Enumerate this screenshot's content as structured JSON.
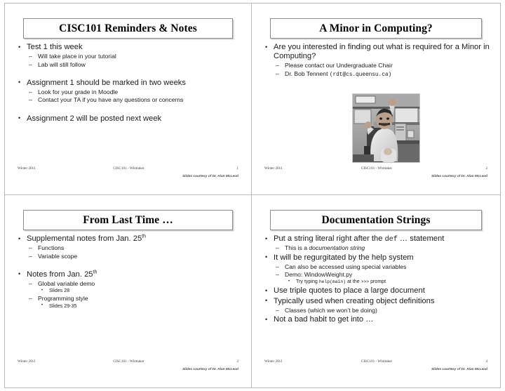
{
  "document": {
    "kind": "lecture-slide-handout",
    "course": "CISC101",
    "grid": "2x2"
  },
  "footer_common": {
    "term": "Winter 2011",
    "course": "CISC101 - Whittaker",
    "credit": "Slides courtesy of Dr. Alan McLeod"
  },
  "slides": [
    {
      "number": "1",
      "title": "CISC101 Reminders & Notes",
      "bullets": [
        {
          "text": "Test 1 this week",
          "sub": [
            {
              "text": "Will take place in your tutorial"
            },
            {
              "text": "Lab will still follow"
            }
          ]
        },
        {
          "text": "Assignment 1 should be marked in two weeks",
          "sub": [
            {
              "text": "Look for your grade in Moodle"
            },
            {
              "text": "Contact your TA if you have any questions or concerns"
            }
          ]
        },
        {
          "text": "Assignment 2 will be posted next week",
          "sub": []
        }
      ]
    },
    {
      "number": "2",
      "title": "A Minor in Computing?",
      "bullets": [
        {
          "text": "Are you interested in finding out what is required for a Minor in Computing?",
          "sub": [
            {
              "text": "Please contact our Undergraduate Chair"
            },
            {
              "text": "Dr. Bob Tennent ",
              "mono_suffix": "(rdt@cs.queensu.ca)"
            }
          ]
        }
      ],
      "image": {
        "name": "photo-of-professor",
        "alt": "Grayscale photo of a seated man in a white shirt waving at a desk with computer monitors in an office"
      }
    },
    {
      "number": "3",
      "title": "From Last Time …",
      "bullets": [
        {
          "text_pre": "Supplemental notes from Jan. 25",
          "superscript": "th",
          "sub": [
            {
              "text": "Functions"
            },
            {
              "text": "Variable scope"
            }
          ]
        },
        {
          "text_pre": "Notes from Jan. 25",
          "superscript": "th",
          "sub": [
            {
              "text": "Global variable demo",
              "sub3": [
                {
                  "text": "Slides 28"
                }
              ]
            },
            {
              "text": "Programming style",
              "sub3": [
                {
                  "text": "Slides 29-35"
                }
              ]
            }
          ]
        }
      ]
    },
    {
      "number": "4",
      "title": "Documentation Strings",
      "bullets": [
        {
          "text_pre": "Put a string literal right after the ",
          "mono_mid": "def",
          "text_post": " … statement",
          "sub": [
            {
              "text_pre": "This is a ",
              "italic": "documentation string"
            }
          ]
        },
        {
          "text": "It will be regurgitated by the help system",
          "sub": [
            {
              "text": "Can also be accessed using special variables"
            },
            {
              "text": "Demo: WindowWeight.py",
              "sub3": [
                {
                  "text_pre": "Try typing ",
                  "mono_a": "help(main)",
                  "text_mid": " at the ",
                  "mono_b": ">>>",
                  "text_post": " prompt"
                }
              ]
            }
          ]
        },
        {
          "text": "Use triple quotes to place a large document",
          "sub": []
        },
        {
          "text": "Typically used when creating object definitions",
          "sub": [
            {
              "text": "Classes (which we won’t be doing)"
            }
          ]
        },
        {
          "text": "Not a bad habit to get into …",
          "sub": []
        }
      ]
    }
  ],
  "colors": {
    "page_border": "#b9b9b9",
    "divider": "#bdbdbd",
    "title_border": "#8c8c8c",
    "text": "#1a1a1a",
    "footer_text": "#3a3a3a"
  }
}
